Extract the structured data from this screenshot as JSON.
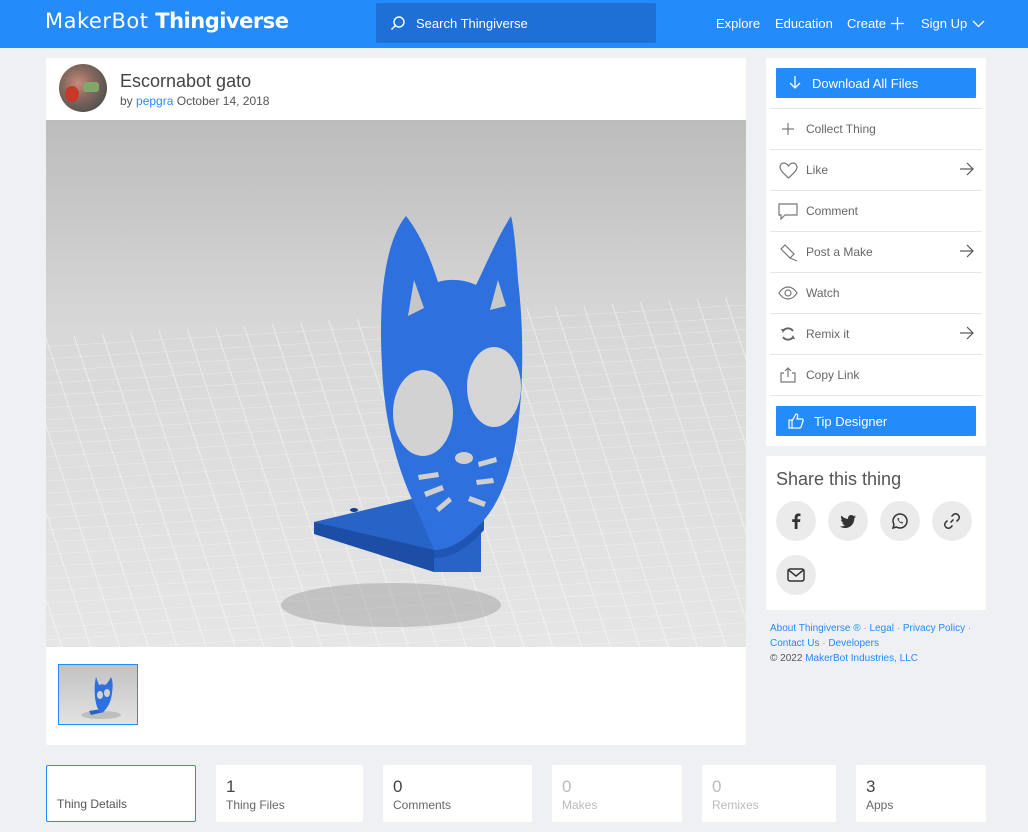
{
  "header": {
    "logo_maker": "MakerBot",
    "logo_thing": "Thingiverse",
    "search_placeholder": "Search Thingiverse",
    "nav": {
      "explore": "Explore",
      "education": "Education",
      "create": "Create",
      "signup": "Sign Up"
    }
  },
  "thing": {
    "title": "Escornabot gato",
    "by": "by",
    "author": "pepgra",
    "date": "October 14, 2018"
  },
  "actions": {
    "download": "Download All Files",
    "items": [
      {
        "label": "Collect Thing",
        "icon": "plus-icon"
      },
      {
        "label": "Like",
        "icon": "heart-icon"
      },
      {
        "label": "Comment",
        "icon": "comment-icon"
      },
      {
        "label": "Post a Make",
        "icon": "make-icon"
      },
      {
        "label": "Watch",
        "icon": "eye-icon"
      },
      {
        "label": "Remix it",
        "icon": "remix-icon"
      },
      {
        "label": "Copy Link",
        "icon": "share-icon"
      }
    ],
    "tip": "Tip Designer"
  },
  "share": {
    "title": "Share this thing",
    "buttons": [
      "facebook-icon",
      "twitter-icon",
      "whatsapp-icon",
      "link-icon",
      "email-icon"
    ]
  },
  "footer": {
    "about": "About Thingiverse ®",
    "legal": "Legal",
    "privacy": "Privacy Policy",
    "contact": "Contact Us",
    "developers": "Developers",
    "copyright": "©  2022",
    "company": "MakerBot Industries, LLC"
  },
  "tabs": [
    {
      "num": "",
      "label": "Thing Details"
    },
    {
      "num": "1",
      "label": "Thing Files"
    },
    {
      "num": "0",
      "label": "Comments"
    },
    {
      "num": "0",
      "label": "Makes"
    },
    {
      "num": "0",
      "label": "Remixes"
    },
    {
      "num": "3",
      "label": "Apps"
    }
  ],
  "colors": {
    "brand": "#248bfb",
    "model": "#2d6fd8"
  }
}
